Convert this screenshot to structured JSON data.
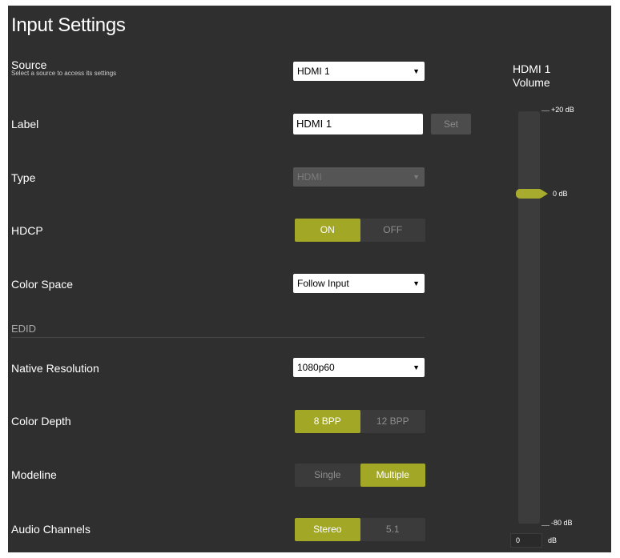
{
  "page": {
    "title": "Input Settings"
  },
  "source": {
    "label": "Source",
    "hint": "Select a source to access its settings",
    "value": "HDMI 1"
  },
  "label_row": {
    "label": "Label",
    "value": "HDMI 1",
    "set_button": "Set"
  },
  "type_row": {
    "label": "Type",
    "value": "HDMI",
    "disabled": true
  },
  "hdcp": {
    "label": "HDCP",
    "options": [
      "ON",
      "OFF"
    ],
    "selected": "ON"
  },
  "color_space": {
    "label": "Color Space",
    "value": "Follow Input"
  },
  "edid": {
    "section_label": "EDID",
    "native_resolution": {
      "label": "Native Resolution",
      "value": "1080p60"
    },
    "color_depth": {
      "label": "Color Depth",
      "options": [
        "8 BPP",
        "12 BPP"
      ],
      "selected": "8 BPP"
    },
    "modeline": {
      "label": "Modeline",
      "options": [
        "Single",
        "Multiple"
      ],
      "selected": "Multiple"
    },
    "audio_channels": {
      "label": "Audio Channels",
      "options": [
        "Stereo",
        "5.1"
      ],
      "selected": "Stereo"
    }
  },
  "volume": {
    "title_line1": "HDMI 1",
    "title_line2": "Volume",
    "max_label": "+20 dB",
    "current_label": "0 dB",
    "min_label": "-80 dB",
    "value": "0",
    "unit": "dB",
    "slider_value_db": 0,
    "range_db": [
      -80,
      20
    ]
  },
  "colors": {
    "panel_bg": "#2f2f2f",
    "accent": "#a2a826",
    "toggle_off_bg": "#3b3b3b"
  },
  "icons": {
    "dropdown_arrow": "triangle-down-icon"
  }
}
